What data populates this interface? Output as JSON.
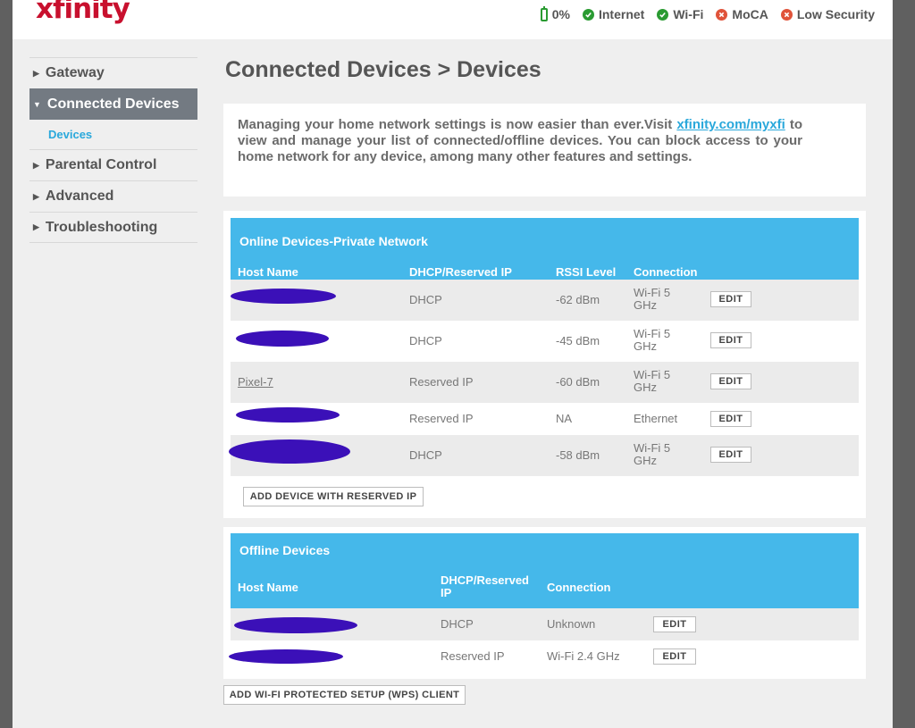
{
  "header": {
    "logo": "xfinity",
    "status": [
      {
        "label": "0%",
        "icon": "battery-icon",
        "color": "#2a9b32"
      },
      {
        "label": "Internet",
        "icon": "check-circle-icon",
        "color": "#2a9b32"
      },
      {
        "label": "Wi-Fi",
        "icon": "check-circle-icon",
        "color": "#2a9b32"
      },
      {
        "label": "MoCA",
        "icon": "x-circle-icon",
        "color": "#e0533a"
      },
      {
        "label": "Low Security",
        "icon": "x-circle-icon",
        "color": "#e0533a"
      }
    ]
  },
  "sidebar": {
    "items": [
      {
        "label": "Gateway"
      },
      {
        "label": "Connected Devices",
        "active": true
      },
      {
        "label": "Devices",
        "sub": true
      },
      {
        "label": "Parental Control"
      },
      {
        "label": "Advanced"
      },
      {
        "label": "Troubleshooting"
      }
    ]
  },
  "main": {
    "title": "Connected Devices > Devices",
    "info": {
      "text_before": "Managing your home network settings is now easier than ever.Visit ",
      "link": "xfinity.com/myxfi",
      "text_after": " to view and manage your list of connected/offline devices. You can block access to your home network for any device, among many other features and settings."
    },
    "online": {
      "title": "Online Devices-Private Network",
      "headers": [
        "Host Name",
        "DHCP/Reserved IP",
        "RSSI Level",
        "Connection"
      ],
      "rows": [
        {
          "host": "",
          "ip": "DHCP",
          "rssi": "-62 dBm",
          "conn1": "Wi-Fi 5",
          "conn2": "GHz",
          "edit": "EDIT"
        },
        {
          "host": "",
          "ip": "DHCP",
          "rssi": "-45 dBm",
          "conn1": "Wi-Fi 5",
          "conn2": "GHz",
          "edit": "EDIT"
        },
        {
          "host": "Pixel-7",
          "ip": "Reserved IP",
          "rssi": "-60 dBm",
          "conn1": "Wi-Fi 5",
          "conn2": "GHz",
          "edit": "EDIT"
        },
        {
          "host": "",
          "ip": "Reserved IP",
          "rssi": "NA",
          "conn1": "Ethernet",
          "conn2": "",
          "edit": "EDIT"
        },
        {
          "host": "",
          "ip": "DHCP",
          "rssi": "-58 dBm",
          "conn1": "Wi-Fi 5",
          "conn2": "GHz",
          "edit": "EDIT"
        }
      ],
      "add_button": "ADD DEVICE WITH RESERVED IP"
    },
    "offline": {
      "title": "Offline Devices",
      "headers": [
        "Host Name",
        "DHCP/Reserved",
        "IP",
        "Connection"
      ],
      "rows": [
        {
          "host": "",
          "ip": "DHCP",
          "conn": "Unknown",
          "edit": "EDIT"
        },
        {
          "host": "",
          "ip": "Reserved IP",
          "conn": "Wi-Fi 2.4 GHz",
          "edit": "EDIT"
        }
      ]
    },
    "wps_button": "ADD WI-FI PROTECTED SETUP (WPS) CLIENT"
  },
  "colors": {
    "brand": "#c8102e",
    "table_header": "#45b8ea",
    "active_nav": "#737a82",
    "link": "#2aa8db",
    "redaction": "#3b10b8"
  }
}
